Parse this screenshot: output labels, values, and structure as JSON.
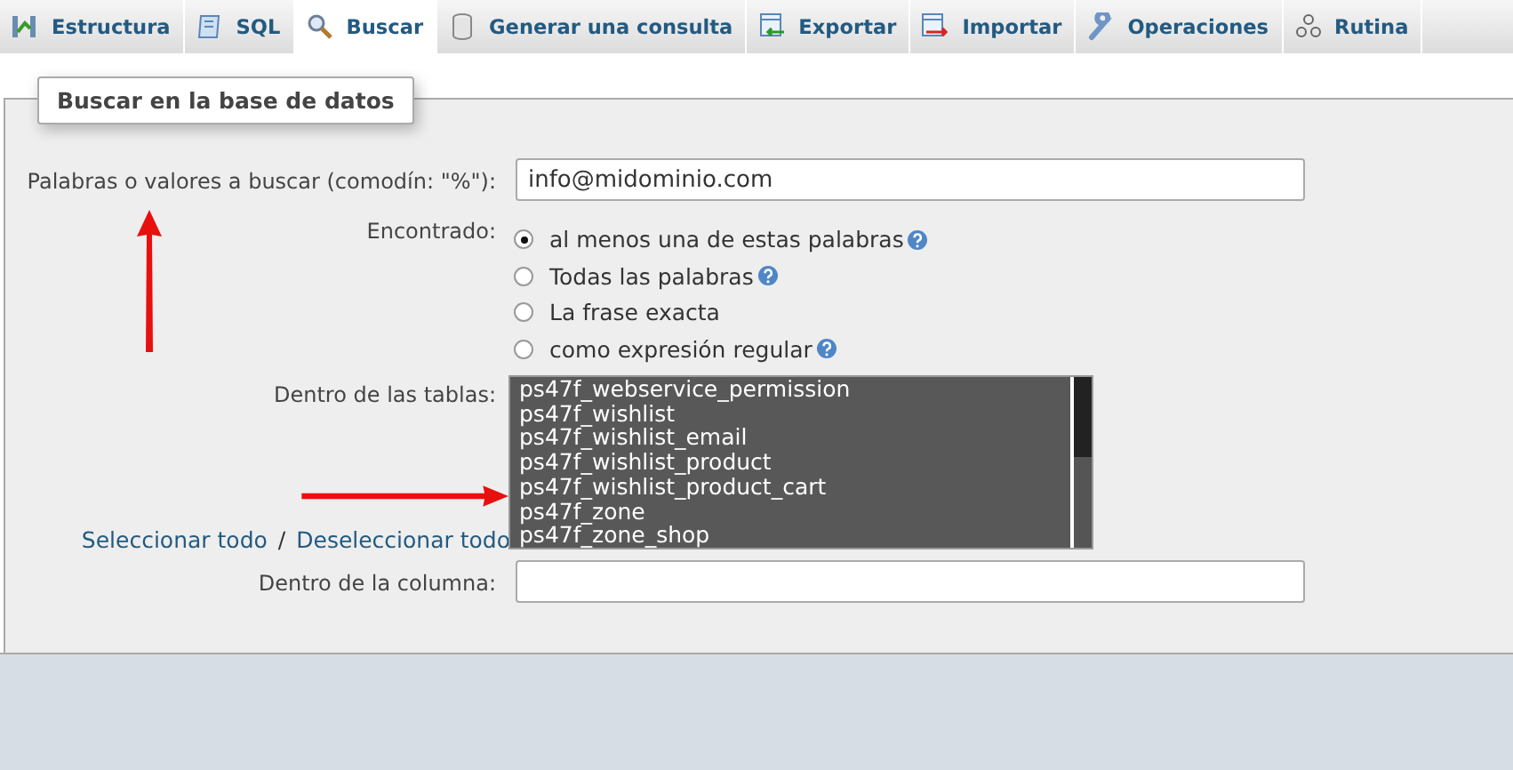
{
  "tabs": [
    {
      "label": "Estructura",
      "selected": false
    },
    {
      "label": "SQL",
      "selected": false
    },
    {
      "label": "Buscar",
      "selected": true
    },
    {
      "label": "Generar una consulta",
      "selected": false
    },
    {
      "label": "Exportar",
      "selected": false
    },
    {
      "label": "Importar",
      "selected": false
    },
    {
      "label": "Operaciones",
      "selected": false
    },
    {
      "label": "Rutina",
      "selected": false
    }
  ],
  "fieldset": {
    "legend": "Buscar en la base de datos"
  },
  "search_words": {
    "label": "Palabras o valores a buscar (comodín: \"%\"):",
    "value": "info@midominio.com"
  },
  "found": {
    "label": "Encontrado:",
    "options": [
      {
        "label": "al menos una de estas palabras",
        "selected": true,
        "help": true
      },
      {
        "label": "Todas las palabras",
        "selected": false,
        "help": true
      },
      {
        "label": "La frase exacta",
        "selected": false,
        "help": false
      },
      {
        "label": "como expresión regular",
        "selected": false,
        "help": true
      }
    ]
  },
  "tables": {
    "label": "Dentro de las tablas:",
    "items": [
      {
        "label": "ps47f_webservice_permission",
        "selected": true
      },
      {
        "label": "ps47f_wishlist",
        "selected": true
      },
      {
        "label": "ps47f_wishlist_email",
        "selected": true
      },
      {
        "label": "ps47f_wishlist_product",
        "selected": true
      },
      {
        "label": "ps47f_wishlist_product_cart",
        "selected": true
      },
      {
        "label": "ps47f_zone",
        "selected": true
      },
      {
        "label": "ps47f_zone_shop",
        "selected": true
      }
    ],
    "select_all": "Seleccionar todo",
    "separator": "/",
    "deselect_all": "Deseleccionar todo"
  },
  "column": {
    "label": "Dentro de la columna:"
  }
}
